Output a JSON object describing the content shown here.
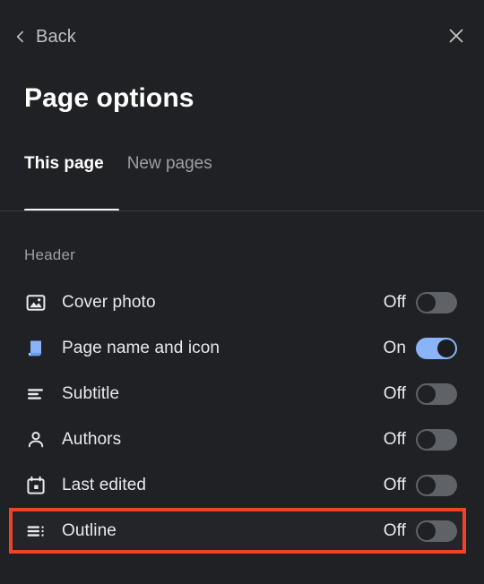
{
  "topbar": {
    "back_label": "Back",
    "back_icon": "chevron-left-icon",
    "close_icon": "close-icon"
  },
  "title": "Page options",
  "tabs": [
    {
      "label": "This page",
      "active": true
    },
    {
      "label": "New pages",
      "active": false
    }
  ],
  "section": {
    "label": "Header"
  },
  "options": [
    {
      "icon": "image-icon",
      "label": "Cover photo",
      "state_label": "Off",
      "on": false,
      "highlighted": false
    },
    {
      "icon": "page-document-icon",
      "label": "Page name and icon",
      "state_label": "On",
      "on": true,
      "highlighted": false
    },
    {
      "icon": "subtitle-lines-icon",
      "label": "Subtitle",
      "state_label": "Off",
      "on": false,
      "highlighted": false
    },
    {
      "icon": "person-icon",
      "label": "Authors",
      "state_label": "Off",
      "on": false,
      "highlighted": false
    },
    {
      "icon": "calendar-icon",
      "label": "Last edited",
      "state_label": "Off",
      "on": false,
      "highlighted": false
    },
    {
      "icon": "outline-list-icon",
      "label": "Outline",
      "state_label": "Off",
      "on": false,
      "highlighted": true
    }
  ],
  "colors": {
    "background": "#202124",
    "accent_blue": "#8ab4f8",
    "highlight_red": "#f04325",
    "text_primary": "#e8eaed",
    "text_secondary": "#9aa0a6",
    "toggle_off_track": "#5f6368"
  }
}
